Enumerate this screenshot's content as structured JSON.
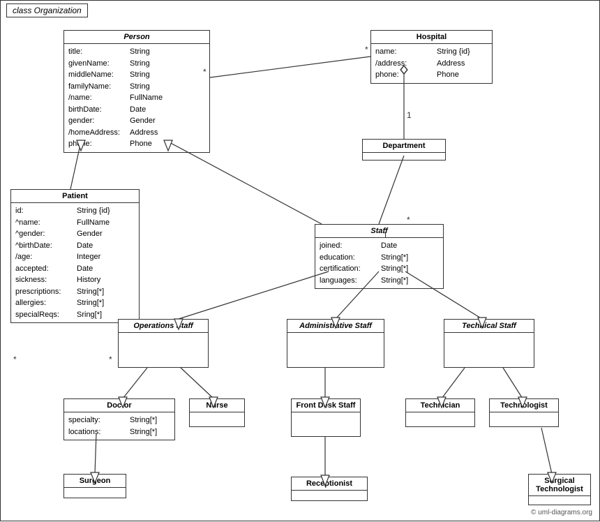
{
  "title": "class Organization",
  "classes": {
    "person": {
      "name": "Person",
      "italic": true,
      "attrs": [
        [
          "title:",
          "String"
        ],
        [
          "givenName:",
          "String"
        ],
        [
          "middleName:",
          "String"
        ],
        [
          "familyName:",
          "String"
        ],
        [
          "/name:",
          "FullName"
        ],
        [
          "birthDate:",
          "Date"
        ],
        [
          "gender:",
          "Gender"
        ],
        [
          "/homeAddress:",
          "Address"
        ],
        [
          "phone:",
          "Phone"
        ]
      ]
    },
    "hospital": {
      "name": "Hospital",
      "italic": false,
      "attrs": [
        [
          "name:",
          "String {id}"
        ],
        [
          "/address:",
          "Address"
        ],
        [
          "phone:",
          "Phone"
        ]
      ]
    },
    "patient": {
      "name": "Patient",
      "italic": false,
      "attrs": [
        [
          "id:",
          "String {id}"
        ],
        [
          "^name:",
          "FullName"
        ],
        [
          "^gender:",
          "Gender"
        ],
        [
          "^birthDate:",
          "Date"
        ],
        [
          "/age:",
          "Integer"
        ],
        [
          "accepted:",
          "Date"
        ],
        [
          "sickness:",
          "History"
        ],
        [
          "prescriptions:",
          "String[*]"
        ],
        [
          "allergies:",
          "String[*]"
        ],
        [
          "specialReqs:",
          "Sring[*]"
        ]
      ]
    },
    "department": {
      "name": "Department",
      "italic": false,
      "attrs": []
    },
    "staff": {
      "name": "Staff",
      "italic": true,
      "attrs": [
        [
          "joined:",
          "Date"
        ],
        [
          "education:",
          "String[*]"
        ],
        [
          "certification:",
          "String[*]"
        ],
        [
          "languages:",
          "String[*]"
        ]
      ]
    },
    "operations_staff": {
      "name": "Operations Staff",
      "italic": true,
      "attrs": []
    },
    "administrative_staff": {
      "name": "Administrative Staff",
      "italic": true,
      "attrs": []
    },
    "technical_staff": {
      "name": "Technical Staff",
      "italic": true,
      "attrs": []
    },
    "doctor": {
      "name": "Doctor",
      "italic": false,
      "attrs": [
        [
          "specialty:",
          "String[*]"
        ],
        [
          "locations:",
          "String[*]"
        ]
      ]
    },
    "nurse": {
      "name": "Nurse",
      "italic": false,
      "attrs": []
    },
    "front_desk_staff": {
      "name": "Front Desk Staff",
      "italic": false,
      "attrs": []
    },
    "technician": {
      "name": "Technician",
      "italic": false,
      "attrs": []
    },
    "technologist": {
      "name": "Technologist",
      "italic": false,
      "attrs": []
    },
    "surgeon": {
      "name": "Surgeon",
      "italic": false,
      "attrs": []
    },
    "receptionist": {
      "name": "Receptionist",
      "italic": false,
      "attrs": []
    },
    "surgical_technologist": {
      "name": "Surgical Technologist",
      "italic": false,
      "attrs": []
    }
  },
  "copyright": "© uml-diagrams.org"
}
